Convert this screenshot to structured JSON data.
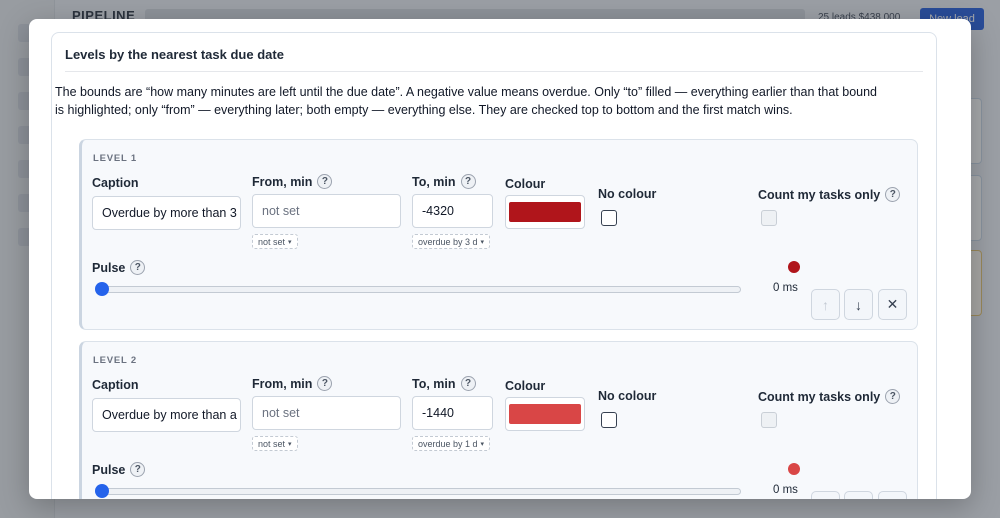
{
  "background": {
    "title": "PIPELINE",
    "stats": "25 leads $438 000",
    "new_lead": "New lead"
  },
  "modal": {
    "section_title": "Levels by the nearest task due date",
    "description": "The bounds are “how many minutes are left until the due date”. A negative value means overdue. Only “to” filled — everything earlier than that bound is highlighted; only “from” — everything later; both empty — everything else. They are checked top to bottom and the first match wins.",
    "labels": {
      "caption": "Caption",
      "from": "From, min",
      "to": "To, min",
      "colour": "Colour",
      "no_colour": "No colour",
      "count_my": "Count my tasks only",
      "pulse": "Pulse",
      "help": "?"
    },
    "buttons": {
      "up": "↑",
      "down": "↓",
      "remove": "✕"
    },
    "levels": [
      {
        "label": "LEVEL 1",
        "caption": "Overdue by more than 3",
        "from_placeholder": "not set",
        "from_chip": "not set",
        "to_value": "-4320",
        "to_chip": "overdue by 3 d",
        "colour": "#b0151b",
        "pulse_ms": "0 ms",
        "pulse_level": 0,
        "caret": "▾"
      },
      {
        "label": "LEVEL 2",
        "caption": "Overdue by more than a",
        "from_placeholder": "not set",
        "from_chip": "not set",
        "to_value": "-1440",
        "to_chip": "overdue by 1 d",
        "colour": "#d94646",
        "pulse_ms": "0 ms",
        "pulse_level": 0,
        "caret": "▾"
      }
    ]
  }
}
